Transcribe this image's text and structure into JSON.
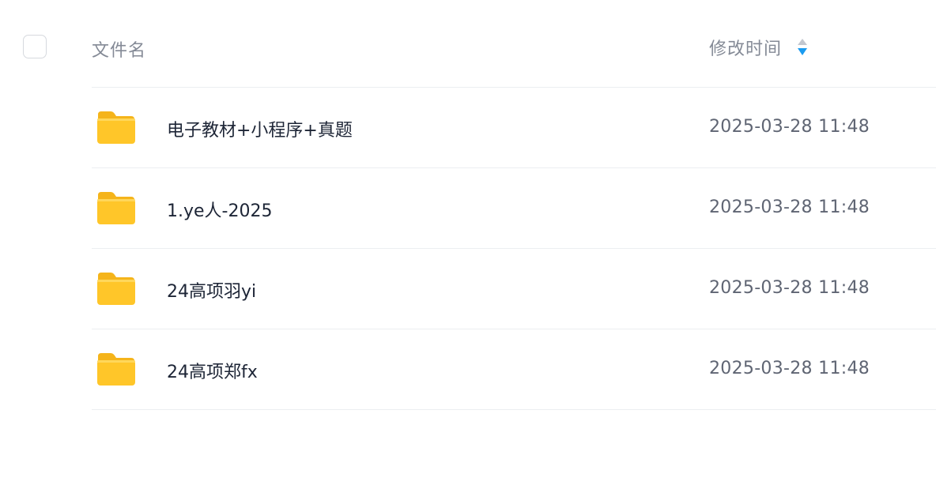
{
  "header": {
    "name_label": "文件名",
    "time_label": "修改时间",
    "sort_icon": "sort-descending-icon"
  },
  "files": [
    {
      "name": "电子教材+小程序+真题",
      "modified": "2025-03-28 11:48",
      "icon": "folder-icon"
    },
    {
      "name": "1.ye人-2025",
      "modified": "2025-03-28 11:48",
      "icon": "folder-icon"
    },
    {
      "name": "24高项羽yi",
      "modified": "2025-03-28 11:48",
      "icon": "folder-icon"
    },
    {
      "name": "24高项郑fx",
      "modified": "2025-03-28 11:48",
      "icon": "folder-icon"
    }
  ],
  "colors": {
    "folder": "#ffc629",
    "folder_tab": "#f5b41a",
    "sort_active": "#1a9bf0",
    "sort_inactive": "#c3c7cf"
  }
}
